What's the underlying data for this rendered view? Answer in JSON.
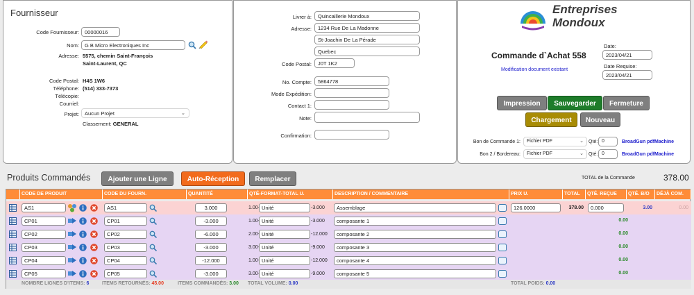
{
  "supplier": {
    "title": "Fournisseur",
    "code_label": "Code Fournisseur:",
    "code_value": "00000016",
    "name_label": "Nom:",
    "name_value": "G B Micro Electroniques Inc",
    "address_label": "Adresse:",
    "address_line1": "5575, chemin Saint-François",
    "address_line2": "Saint-Laurent, QC",
    "postal_label": "Code Postal:",
    "postal_value": "H4S 1W6",
    "phone_label": "Téléphone:",
    "phone_value": "(514) 333-7373",
    "fax_label": "Télécopie:",
    "email_label": "Courriel:",
    "project_label": "Projet:",
    "project_value": "Aucun Projet",
    "class_label": "Classement:",
    "class_value": "GENERAL"
  },
  "delivery": {
    "deliver_label": "Livrer à:",
    "deliver_value": "Quincaillerie Mondoux",
    "address_label": "Adresse:",
    "address_line1": "1234 Rue De La Madonne",
    "address_line2": "St-Joachin De La Pérade",
    "address_line3": "Quebec",
    "postal_label": "Code Postal:",
    "postal_value": "J0T 1K2",
    "account_label": "No. Compte:",
    "account_value": "5864778",
    "shipping_label": "Mode Expédition:",
    "contact_label": "Contact 1:",
    "note_label": "Note:",
    "confirm_label": "Confirmation:"
  },
  "order": {
    "logo_line1": "Entreprises",
    "logo_line2": "Mondoux",
    "title": "Commande d`Achat 558",
    "status": "Modification document existant",
    "date_label": "Date:",
    "date_value": "2023/04/21",
    "date_req_label": "Date Requise:",
    "date_req_value": "2023/04/21",
    "btn_print": "Impression",
    "btn_save": "Sauvegarder",
    "btn_close": "Fermeture",
    "btn_load": "Chargement",
    "btn_new": "Nouveau",
    "bc1_label": "Bon de Commande 1:",
    "bc1_format": "Fichier PDF",
    "bc1_qty_label": "Qté:",
    "bc1_qty": "0",
    "bc1_link": "BroadGun pdfMachine",
    "bc2_label": "Bon 2 / Bordereau:",
    "bc2_format": "Fichier PDF",
    "bc2_qty_label": "Qté:",
    "bc2_qty": "0",
    "bc2_link": "BroadGun pdfMachine"
  },
  "products": {
    "title": "Produits Commandés",
    "btn_add": "Ajouter une Ligne",
    "btn_auto": "Auto-Réception",
    "btn_replace": "Remplacer",
    "total_label": "TOTAL de la Commande",
    "total_value": "378.00",
    "headers": {
      "code": "CODE DE PRODUIT",
      "supplier_code": "CODE DU FOURN.",
      "qty": "QUANTITÉ",
      "format": "QTÉ-FORMAT-TOTAL U.",
      "desc": "DESCRIPTION / COMMENTAIRE",
      "price": "PRIX U.",
      "total": "TOTAL",
      "received": "QTÉ. REÇUE",
      "bo": "QTÉ. B/O",
      "already": "DÉJÀ COM."
    },
    "rows": [
      {
        "code": "AS1",
        "supplier_code": "AS1",
        "qty": "3.000",
        "fmt_qty": "1.00-",
        "unit": "Unité",
        "fmt_total": "-3.000",
        "desc": "Assemblage",
        "price": "126.0000",
        "total": "378.00",
        "received": "0.000",
        "bo": "3.00",
        "already": "0.00"
      },
      {
        "code": "CP01",
        "supplier_code": "CP01",
        "qty": "-3.000",
        "fmt_qty": "1.00-",
        "unit": "Unité",
        "fmt_total": "-3.000",
        "desc": "composante 1",
        "received_g": "0.00"
      },
      {
        "code": "CP02",
        "supplier_code": "CP02",
        "qty": "-6.000",
        "fmt_qty": "2.00-",
        "unit": "Unité",
        "fmt_total": "-12.000",
        "desc": "composante 2",
        "received_g": "0.00"
      },
      {
        "code": "CP03",
        "supplier_code": "CP03",
        "qty": "-3.000",
        "fmt_qty": "3.00-",
        "unit": "Unité",
        "fmt_total": "-9.000",
        "desc": "composante 3",
        "received_g": "0.00"
      },
      {
        "code": "CP04",
        "supplier_code": "CP04",
        "qty": "-12.000",
        "fmt_qty": "1.00-",
        "unit": "Unité",
        "fmt_total": "-12.000",
        "desc": "composante 4",
        "received_g": "0.00"
      },
      {
        "code": "CP05",
        "supplier_code": "CP05",
        "qty": "-3.000",
        "fmt_qty": "3.00-",
        "unit": "Unité",
        "fmt_total": "-9.000",
        "desc": "composante 5",
        "received_g": "0.00"
      }
    ],
    "footer": {
      "lines_label": "NOMBRE LIGNES D'ITEMS:",
      "lines_value": "6",
      "returned_label": "ITEMS RETOURNÉS:",
      "returned_value": "45.00",
      "ordered_label": "ITEMS COMMANDÉS:",
      "ordered_value": "3.00",
      "volume_label": "TOTAL VOLUME:",
      "volume_value": "0.00",
      "weight_label": "TOTAL POIDS:",
      "weight_value": "0.00"
    }
  },
  "colors": {
    "header_orange": "#ff8c38",
    "row_pink": "#fbd3d3",
    "row_purple": "#e6d5f3",
    "save_green": "#1e7c2a",
    "load_olive": "#a88c05",
    "link_blue": "#1a1acc",
    "returned_red": "#e53a1e",
    "ordered_green": "#2b8a2b"
  }
}
